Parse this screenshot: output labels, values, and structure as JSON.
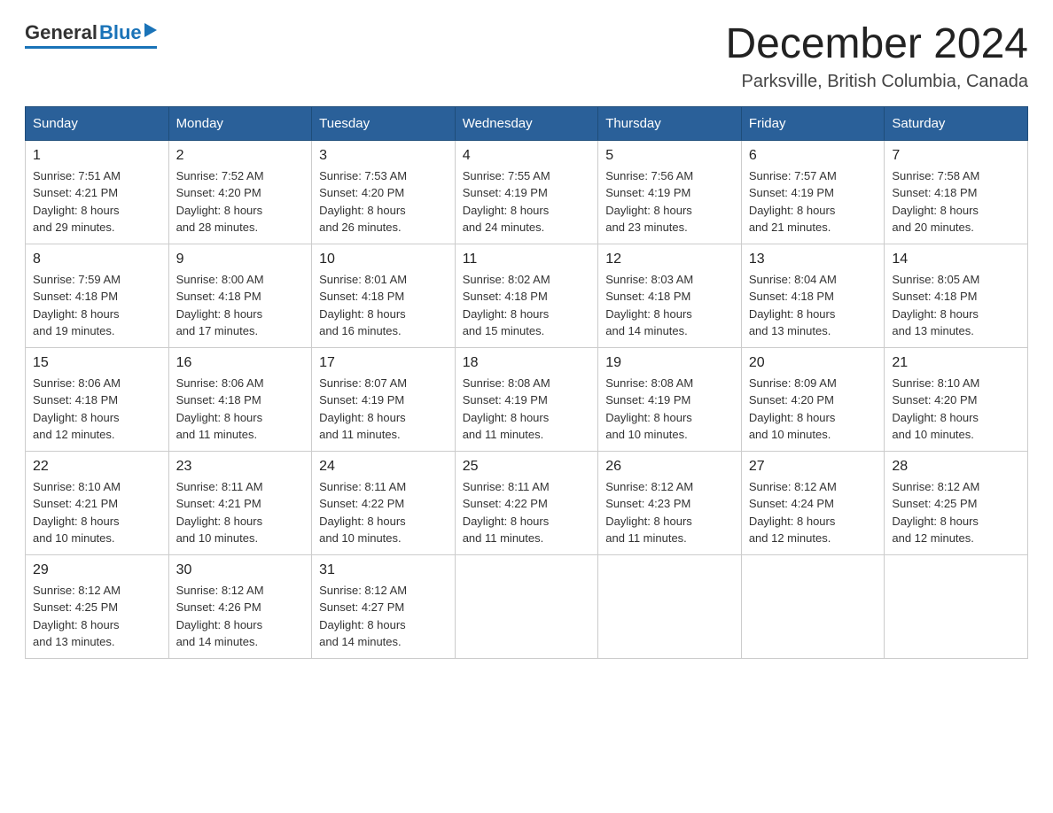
{
  "header": {
    "logo_general": "General",
    "logo_blue": "Blue",
    "month": "December 2024",
    "location": "Parksville, British Columbia, Canada"
  },
  "days_of_week": [
    "Sunday",
    "Monday",
    "Tuesday",
    "Wednesday",
    "Thursday",
    "Friday",
    "Saturday"
  ],
  "weeks": [
    [
      {
        "day": "1",
        "sunrise": "7:51 AM",
        "sunset": "4:21 PM",
        "daylight": "8 hours and 29 minutes."
      },
      {
        "day": "2",
        "sunrise": "7:52 AM",
        "sunset": "4:20 PM",
        "daylight": "8 hours and 28 minutes."
      },
      {
        "day": "3",
        "sunrise": "7:53 AM",
        "sunset": "4:20 PM",
        "daylight": "8 hours and 26 minutes."
      },
      {
        "day": "4",
        "sunrise": "7:55 AM",
        "sunset": "4:19 PM",
        "daylight": "8 hours and 24 minutes."
      },
      {
        "day": "5",
        "sunrise": "7:56 AM",
        "sunset": "4:19 PM",
        "daylight": "8 hours and 23 minutes."
      },
      {
        "day": "6",
        "sunrise": "7:57 AM",
        "sunset": "4:19 PM",
        "daylight": "8 hours and 21 minutes."
      },
      {
        "day": "7",
        "sunrise": "7:58 AM",
        "sunset": "4:18 PM",
        "daylight": "8 hours and 20 minutes."
      }
    ],
    [
      {
        "day": "8",
        "sunrise": "7:59 AM",
        "sunset": "4:18 PM",
        "daylight": "8 hours and 19 minutes."
      },
      {
        "day": "9",
        "sunrise": "8:00 AM",
        "sunset": "4:18 PM",
        "daylight": "8 hours and 17 minutes."
      },
      {
        "day": "10",
        "sunrise": "8:01 AM",
        "sunset": "4:18 PM",
        "daylight": "8 hours and 16 minutes."
      },
      {
        "day": "11",
        "sunrise": "8:02 AM",
        "sunset": "4:18 PM",
        "daylight": "8 hours and 15 minutes."
      },
      {
        "day": "12",
        "sunrise": "8:03 AM",
        "sunset": "4:18 PM",
        "daylight": "8 hours and 14 minutes."
      },
      {
        "day": "13",
        "sunrise": "8:04 AM",
        "sunset": "4:18 PM",
        "daylight": "8 hours and 13 minutes."
      },
      {
        "day": "14",
        "sunrise": "8:05 AM",
        "sunset": "4:18 PM",
        "daylight": "8 hours and 13 minutes."
      }
    ],
    [
      {
        "day": "15",
        "sunrise": "8:06 AM",
        "sunset": "4:18 PM",
        "daylight": "8 hours and 12 minutes."
      },
      {
        "day": "16",
        "sunrise": "8:06 AM",
        "sunset": "4:18 PM",
        "daylight": "8 hours and 11 minutes."
      },
      {
        "day": "17",
        "sunrise": "8:07 AM",
        "sunset": "4:19 PM",
        "daylight": "8 hours and 11 minutes."
      },
      {
        "day": "18",
        "sunrise": "8:08 AM",
        "sunset": "4:19 PM",
        "daylight": "8 hours and 11 minutes."
      },
      {
        "day": "19",
        "sunrise": "8:08 AM",
        "sunset": "4:19 PM",
        "daylight": "8 hours and 10 minutes."
      },
      {
        "day": "20",
        "sunrise": "8:09 AM",
        "sunset": "4:20 PM",
        "daylight": "8 hours and 10 minutes."
      },
      {
        "day": "21",
        "sunrise": "8:10 AM",
        "sunset": "4:20 PM",
        "daylight": "8 hours and 10 minutes."
      }
    ],
    [
      {
        "day": "22",
        "sunrise": "8:10 AM",
        "sunset": "4:21 PM",
        "daylight": "8 hours and 10 minutes."
      },
      {
        "day": "23",
        "sunrise": "8:11 AM",
        "sunset": "4:21 PM",
        "daylight": "8 hours and 10 minutes."
      },
      {
        "day": "24",
        "sunrise": "8:11 AM",
        "sunset": "4:22 PM",
        "daylight": "8 hours and 10 minutes."
      },
      {
        "day": "25",
        "sunrise": "8:11 AM",
        "sunset": "4:22 PM",
        "daylight": "8 hours and 11 minutes."
      },
      {
        "day": "26",
        "sunrise": "8:12 AM",
        "sunset": "4:23 PM",
        "daylight": "8 hours and 11 minutes."
      },
      {
        "day": "27",
        "sunrise": "8:12 AM",
        "sunset": "4:24 PM",
        "daylight": "8 hours and 12 minutes."
      },
      {
        "day": "28",
        "sunrise": "8:12 AM",
        "sunset": "4:25 PM",
        "daylight": "8 hours and 12 minutes."
      }
    ],
    [
      {
        "day": "29",
        "sunrise": "8:12 AM",
        "sunset": "4:25 PM",
        "daylight": "8 hours and 13 minutes."
      },
      {
        "day": "30",
        "sunrise": "8:12 AM",
        "sunset": "4:26 PM",
        "daylight": "8 hours and 14 minutes."
      },
      {
        "day": "31",
        "sunrise": "8:12 AM",
        "sunset": "4:27 PM",
        "daylight": "8 hours and 14 minutes."
      },
      null,
      null,
      null,
      null
    ]
  ],
  "labels": {
    "sunrise": "Sunrise:",
    "sunset": "Sunset:",
    "daylight": "Daylight:"
  }
}
